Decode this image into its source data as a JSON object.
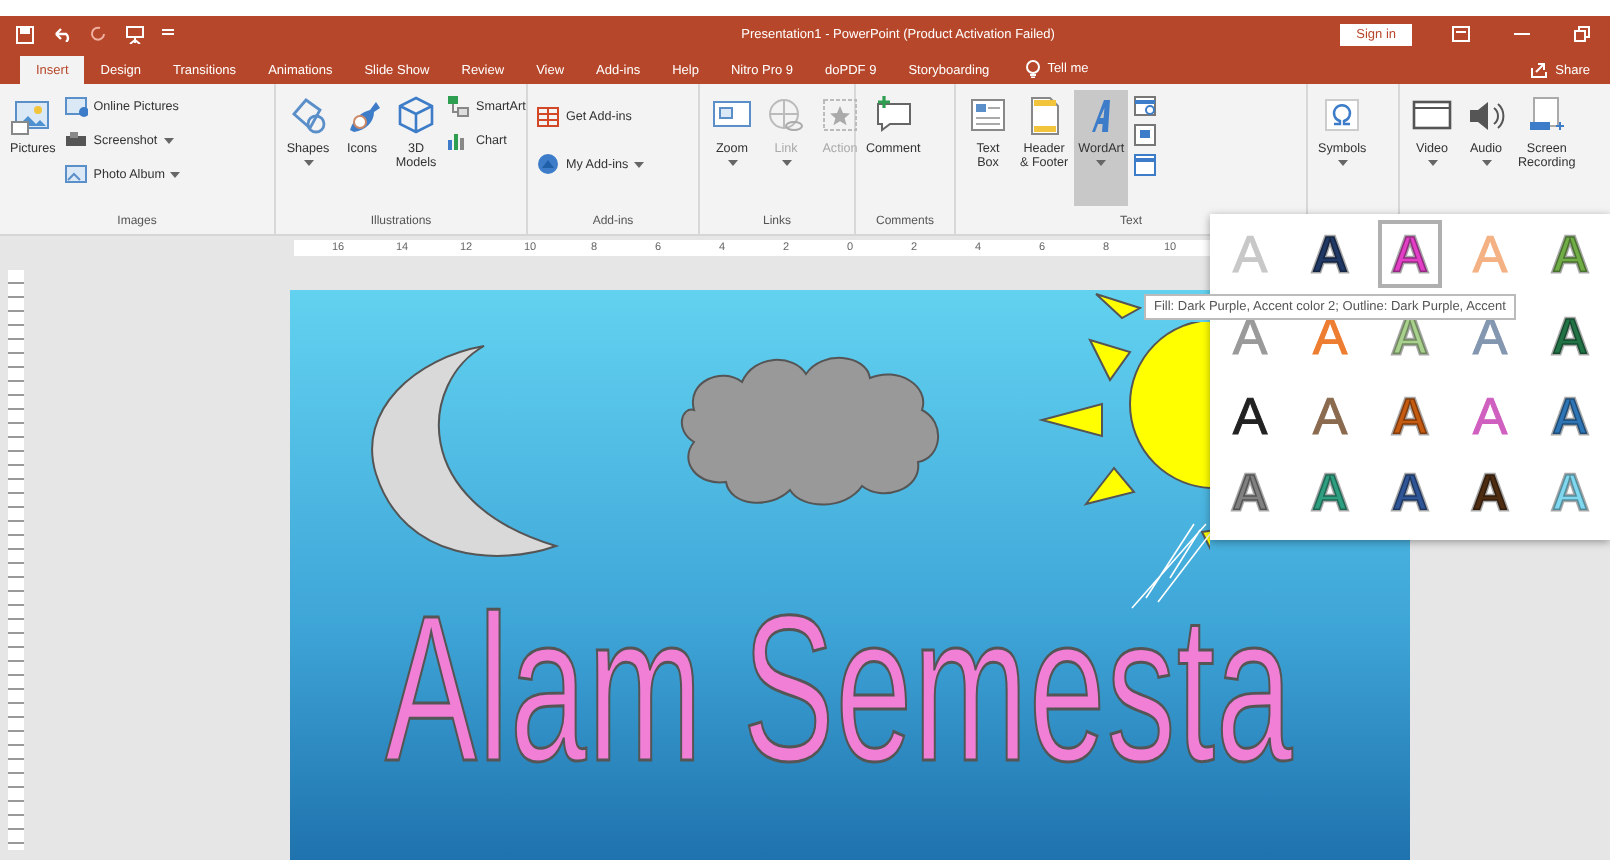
{
  "title_bar": {
    "title": "Presentation1 - PowerPoint (Product Activation Failed)",
    "sign_in": "Sign in"
  },
  "tabs": [
    {
      "label": "Insert",
      "selected": true
    },
    {
      "label": "Design",
      "selected": false
    },
    {
      "label": "Transitions",
      "selected": false
    },
    {
      "label": "Animations",
      "selected": false
    },
    {
      "label": "Slide Show",
      "selected": false
    },
    {
      "label": "Review",
      "selected": false
    },
    {
      "label": "View",
      "selected": false
    },
    {
      "label": "Add-ins",
      "selected": false
    },
    {
      "label": "Help",
      "selected": false
    },
    {
      "label": "Nitro Pro 9",
      "selected": false
    },
    {
      "label": "doPDF 9",
      "selected": false
    },
    {
      "label": "Storyboarding",
      "selected": false
    }
  ],
  "tell_me": "Tell me",
  "share": "Share",
  "ribbon": {
    "groups": [
      {
        "label": "Images",
        "items": [
          {
            "kind": "large",
            "label": "Pictures",
            "dropdown": false,
            "disabled": false,
            "pressed": false
          },
          {
            "kind": "stack",
            "items": [
              {
                "label": "Online Pictures",
                "dropdown": false
              },
              {
                "label": "Screenshot",
                "dropdown": true
              },
              {
                "label": "Photo Album",
                "dropdown": true
              }
            ]
          }
        ]
      },
      {
        "label": "Illustrations",
        "items": [
          {
            "kind": "large",
            "label": "Shapes",
            "dropdown": true,
            "disabled": false,
            "pressed": false
          },
          {
            "kind": "large",
            "label": "Icons",
            "dropdown": false,
            "disabled": false,
            "pressed": false
          },
          {
            "kind": "large",
            "label": "3D\nModels",
            "dropdown": false,
            "disabled": false,
            "pressed": false
          },
          {
            "kind": "stack",
            "items": [
              {
                "label": "SmartArt",
                "dropdown": false
              },
              {
                "label": "Chart",
                "dropdown": false
              }
            ]
          }
        ]
      },
      {
        "label": "Add-ins",
        "items": [
          {
            "kind": "stack",
            "items": [
              {
                "label": "Get Add-ins",
                "dropdown": false
              },
              {
                "label": "My Add-ins",
                "dropdown": true
              }
            ]
          }
        ]
      },
      {
        "label": "Links",
        "items": [
          {
            "kind": "large",
            "label": "Zoom",
            "dropdown": true,
            "disabled": false,
            "pressed": false
          },
          {
            "kind": "large",
            "label": "Link",
            "dropdown": true,
            "disabled": true,
            "pressed": false
          },
          {
            "kind": "large",
            "label": "Action",
            "dropdown": false,
            "disabled": true,
            "pressed": false
          }
        ]
      },
      {
        "label": "Comments",
        "items": [
          {
            "kind": "large",
            "label": "Comment",
            "dropdown": false,
            "disabled": false,
            "pressed": false
          }
        ]
      },
      {
        "label": "Text",
        "items": [
          {
            "kind": "large",
            "label": "Text\nBox",
            "dropdown": false,
            "disabled": false,
            "pressed": false
          },
          {
            "kind": "large",
            "label": "Header\n& Footer",
            "dropdown": false,
            "disabled": false,
            "pressed": false
          },
          {
            "kind": "large",
            "label": "WordArt",
            "dropdown": true,
            "disabled": false,
            "pressed": true
          },
          {
            "kind": "icons"
          }
        ]
      },
      {
        "items": [
          {
            "kind": "large",
            "label": "Symbols",
            "dropdown": true,
            "disabled": false,
            "pressed": false
          }
        ]
      },
      {
        "items": [
          {
            "kind": "large",
            "label": "Video",
            "dropdown": true,
            "disabled": false,
            "pressed": false
          },
          {
            "kind": "large",
            "label": "Audio",
            "dropdown": true,
            "disabled": false,
            "pressed": false
          },
          {
            "kind": "large",
            "label": "Screen\nRecording",
            "dropdown": false,
            "disabled": false,
            "pressed": false
          }
        ]
      }
    ]
  },
  "ruler": {
    "labels": [
      "16",
      "14",
      "12",
      "10",
      "8",
      "6",
      "4",
      "2",
      "0",
      "2",
      "4",
      "6",
      "8",
      "10"
    ]
  },
  "slide": {
    "wordart": "Alam Semesta"
  },
  "wordart_gallery": {
    "tooltip": "Fill: Dark Purple, Accent color 2; Outline: Dark Purple, Accent",
    "styles": [
      {
        "letter": "A",
        "kind": "outline",
        "color": "#c8c8c8",
        "selected": false
      },
      {
        "letter": "A",
        "kind": "fill",
        "color": "#1f3864",
        "selected": false
      },
      {
        "letter": "A",
        "kind": "fill",
        "color": "#e23fc6",
        "selected": true
      },
      {
        "letter": "A",
        "kind": "outline",
        "color": "#f4b183",
        "selected": false
      },
      {
        "letter": "A",
        "kind": "fill",
        "color": "#70ad47",
        "selected": false
      },
      {
        "letter": "A",
        "kind": "outline",
        "color": "#9a9a9a",
        "selected": false
      },
      {
        "letter": "A",
        "kind": "outline",
        "color": "#ed7d31",
        "selected": false
      },
      {
        "letter": "A",
        "kind": "fill",
        "color": "#a9d18e",
        "selected": false
      },
      {
        "letter": "A",
        "kind": "outline",
        "color": "#8497b0",
        "selected": false
      },
      {
        "letter": "A",
        "kind": "fill",
        "color": "#217346",
        "selected": false
      },
      {
        "letter": "A",
        "kind": "outline",
        "color": "#222222",
        "selected": false
      },
      {
        "letter": "A",
        "kind": "outline",
        "color": "#8b6b50",
        "selected": false
      },
      {
        "letter": "A",
        "kind": "fill",
        "color": "#c55a11",
        "selected": false
      },
      {
        "letter": "A",
        "kind": "outline",
        "color": "#d060c0",
        "selected": false
      },
      {
        "letter": "A",
        "kind": "fill",
        "color": "#2e75b6",
        "selected": false
      },
      {
        "letter": "A",
        "kind": "fill",
        "color": "#808080",
        "selected": false
      },
      {
        "letter": "A",
        "kind": "fill",
        "color": "#2e9e80",
        "selected": false
      },
      {
        "letter": "A",
        "kind": "fill",
        "color": "#2f5597",
        "selected": false
      },
      {
        "letter": "A",
        "kind": "fill",
        "color": "#4d2c12",
        "selected": false
      },
      {
        "letter": "A",
        "kind": "fill",
        "color": "#7fd8f0",
        "selected": false
      }
    ]
  }
}
